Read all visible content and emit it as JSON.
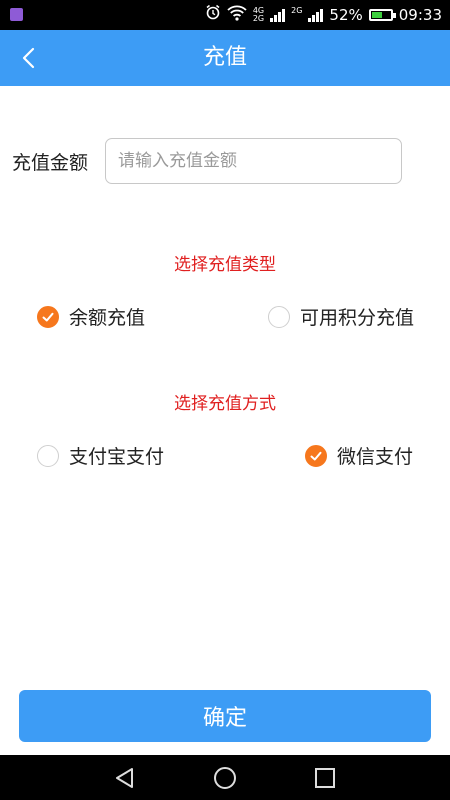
{
  "status_bar": {
    "network_top": "4G",
    "network_bottom": "2G",
    "network2": "2G",
    "battery_percent": "52%",
    "battery_level": 0.52,
    "time": "09:33"
  },
  "header": {
    "title": "充值",
    "back_icon": "chevron-left-icon"
  },
  "amount": {
    "label": "充值金额",
    "placeholder": "请输入充值金额",
    "value": ""
  },
  "recharge_type": {
    "title": "选择充值类型",
    "options": [
      {
        "label": "余额充值",
        "checked": true
      },
      {
        "label": "可用积分充值",
        "checked": false
      }
    ]
  },
  "payment_method": {
    "title": "选择充值方式",
    "options": [
      {
        "label": "支付宝支付",
        "checked": false
      },
      {
        "label": "微信支付",
        "checked": true
      }
    ]
  },
  "confirm_label": "确定",
  "colors": {
    "primary": "#3d9cf5",
    "accent": "#f6771d",
    "section_title": "#e02020"
  },
  "nav_bar": {
    "icons": [
      "back-triangle-icon",
      "home-circle-icon",
      "recents-square-icon"
    ]
  }
}
